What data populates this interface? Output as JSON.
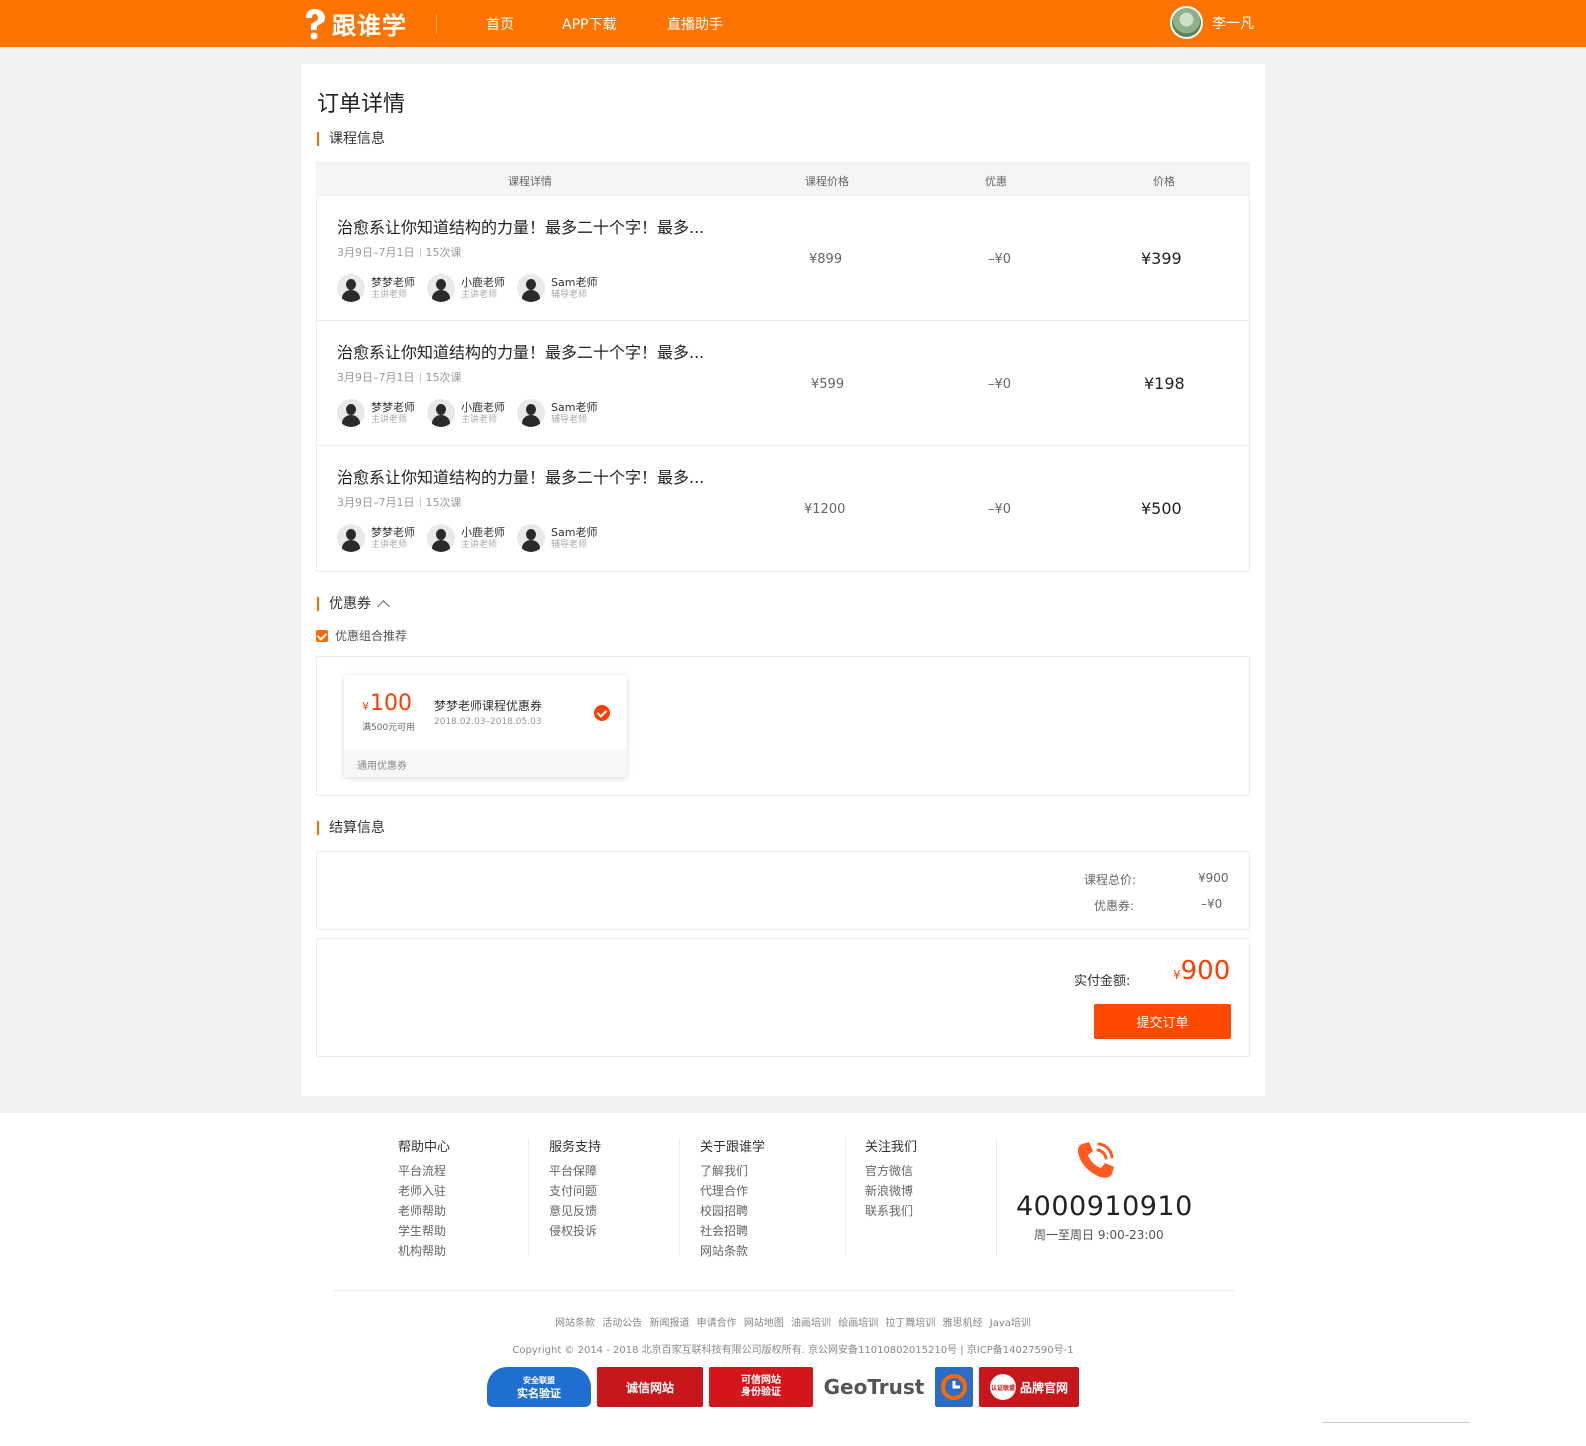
{
  "header": {
    "logo_text": "跟谁学",
    "nav": [
      "首页",
      "APP下载",
      "直播助手"
    ],
    "user_name": "李一凡"
  },
  "page": {
    "title": "订单详情",
    "section_course": "课程信息",
    "section_coupon": "优惠券",
    "section_settle": "结算信息"
  },
  "table": {
    "headers": [
      "课程详情",
      "课程价格",
      "优惠",
      "价格"
    ],
    "rows": [
      {
        "title": "治愈系让你知道结构的力量！最多二十个字！最多...",
        "date": "3月9日–7月1日",
        "lessons": "15次课",
        "course_price": "¥899",
        "discount": "–¥0",
        "price": "¥399",
        "teachers": [
          {
            "name": "梦梦老师",
            "role": "主讲老师"
          },
          {
            "name": "小鹿老师",
            "role": "主讲老师"
          },
          {
            "name": "Sam老师",
            "role": "辅导老师"
          }
        ]
      },
      {
        "title": "治愈系让你知道结构的力量！最多二十个字！最多...",
        "date": "3月9日–7月1日",
        "lessons": "15次课",
        "course_price": "¥599",
        "discount": "–¥0",
        "price": "¥198",
        "teachers": [
          {
            "name": "梦梦老师",
            "role": "主讲老师"
          },
          {
            "name": "小鹿老师",
            "role": "主讲老师"
          },
          {
            "name": "Sam老师",
            "role": "辅导老师"
          }
        ]
      },
      {
        "title": "治愈系让你知道结构的力量！最多二十个字！最多...",
        "date": "3月9日–7月1日",
        "lessons": "15次课",
        "course_price": "¥1200",
        "discount": "–¥0",
        "price": "¥500",
        "teachers": [
          {
            "name": "梦梦老师",
            "role": "主讲老师"
          },
          {
            "name": "小鹿老师",
            "role": "主讲老师"
          },
          {
            "name": "Sam老师",
            "role": "辅导老师"
          }
        ]
      }
    ]
  },
  "coupon": {
    "combo_label": "优惠组合推荐",
    "combo_checked": true,
    "currency": "¥",
    "amount": "100",
    "condition": "满500元可用",
    "name": "梦梦老师课程优惠券",
    "date_range": "2018.02.03–2018.05.03",
    "type": "通用优惠券",
    "selected": true
  },
  "settlement": {
    "total_label": "课程总价:",
    "total_value": "¥900",
    "coupon_label": "优惠券:",
    "coupon_value": "–¥0",
    "pay_label": "实付金额:",
    "pay_currency": "¥",
    "pay_amount": "900",
    "submit_label": "提交订单"
  },
  "footer": {
    "columns": [
      {
        "title": "帮助中心",
        "items": [
          "平台流程",
          "老师入驻",
          "老师帮助",
          "学生帮助",
          "机构帮助"
        ]
      },
      {
        "title": "服务支持",
        "items": [
          "平台保障",
          "支付问题",
          "意见反馈",
          "侵权投诉"
        ]
      },
      {
        "title": "关于跟谁学",
        "items": [
          "了解我们",
          "代理合作",
          "校园招聘",
          "社会招聘",
          "网站条款"
        ]
      },
      {
        "title": "关注我们",
        "items": [
          "官方微信",
          "新浪微博",
          "联系我们"
        ]
      }
    ],
    "phone": "4000910910",
    "hours": "周一至周日 9:00-23:00",
    "links": [
      "网站条款",
      "活动公告",
      "新闻报道",
      "申请合作",
      "网站地图",
      "油画培训",
      "绘画培训",
      "拉丁舞培训",
      "雅思机经",
      "Java培训"
    ],
    "copyright": "Copyright © 2014 - 2018 北京百家互联科技有限公司版权所有. 京公网安备11010802015210号 | 京ICP备14027590号-1",
    "badges": [
      "实名验证",
      "诚信网站",
      "可信网站 身份验证",
      "GeoTrust",
      "",
      "品牌官网"
    ],
    "badge_text": {
      "b1_top": "安全联盟",
      "b3_line1": "可信网站",
      "b3_line2": "身份验证",
      "b6_seal": "认证联盟"
    }
  },
  "colors": {
    "brand": "#ff7400",
    "accent": "#ff3d00",
    "button": "#ff4800"
  }
}
